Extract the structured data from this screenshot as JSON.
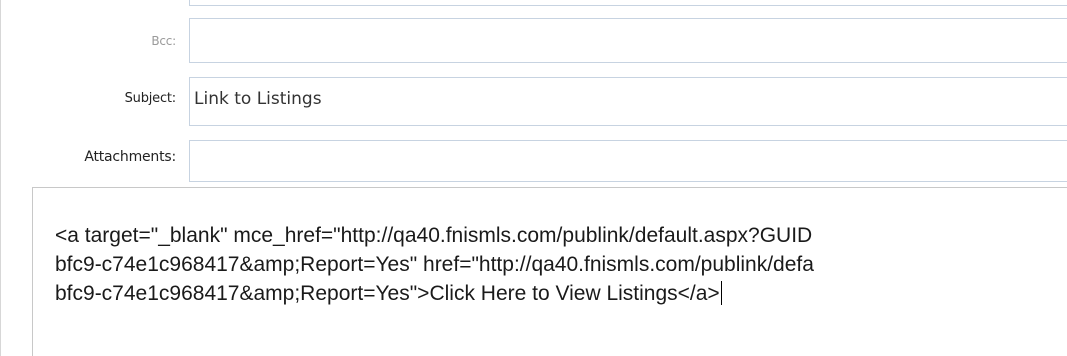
{
  "fields": {
    "bcc": {
      "label": "Bcc:",
      "value": ""
    },
    "subject": {
      "label": "Subject:",
      "value": "Link to Listings"
    },
    "attachments": {
      "label": "Attachments:",
      "value": ""
    }
  },
  "body_editor": {
    "lines": [
      "<a target=\"_blank\" mce_href=\"http://qa40.fnismls.com/publink/default.aspx?GUID",
      "bfc9-c74e1c968417&amp;Report=Yes\" href=\"http://qa40.fnismls.com/publink/defa",
      "bfc9-c74e1c968417&amp;Report=Yes\">Click Here to View Listings</a>"
    ]
  },
  "colors": {
    "input_border": "#c7d3e1",
    "muted_label": "#9a9a9a"
  }
}
